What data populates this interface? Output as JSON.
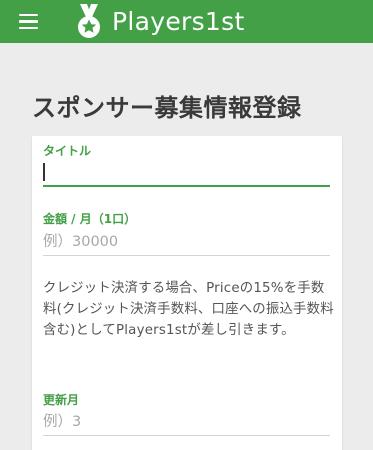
{
  "app_bar": {
    "brand": "Players1st",
    "menu_icon": "hamburger-menu-icon",
    "logo_icon": "medal-logo-icon",
    "color": "#43a047"
  },
  "page": {
    "title": "スポンサー募集情報登録"
  },
  "form": {
    "title_field": {
      "label": "タイトル",
      "value": "",
      "placeholder": ""
    },
    "amount_field": {
      "label": "金額 / 月（1口）",
      "value": "",
      "placeholder": "例）30000"
    },
    "note": "クレジット決済する場合、Priceの15%を手数料(クレジット決済手数料、口座への振込手数料含む)としてPlayers1stが差し引きます。",
    "renewal_field": {
      "label": "更新月",
      "value": "",
      "placeholder": "例）3"
    }
  }
}
